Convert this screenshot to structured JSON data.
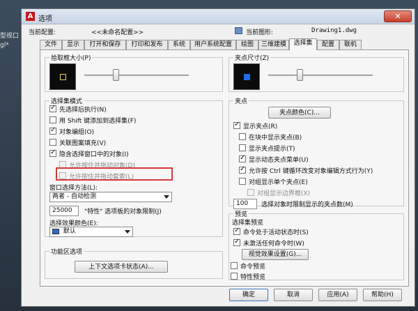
{
  "background": {
    "left_label_1": "型视口",
    "left_label_2": "gl*"
  },
  "window": {
    "title": "选项",
    "close_glyph": "✕"
  },
  "profile": {
    "current_label": "当前配置:",
    "current_value": "<<未命名配置>>",
    "drawing_label": "当前图形:",
    "drawing_value": "Drawing1.dwg"
  },
  "tabs": [
    "文件",
    "显示",
    "打开和保存",
    "打印和发布",
    "系统",
    "用户系统配置",
    "绘图",
    "三维建模",
    "选择集",
    "配置",
    "联机"
  ],
  "active_tab": "选择集",
  "pickbox": {
    "title": "拾取框大小(P)",
    "level": 0.3
  },
  "grip_size": {
    "title": "夹点尺寸(Z)",
    "level": 0.3
  },
  "selection_modes": {
    "title": "选择集模式",
    "items": [
      {
        "label": "先选择后执行(N)",
        "checked": true
      },
      {
        "label": "用 Shift 键添加到选择集(F)",
        "checked": false
      },
      {
        "label": "对象编组(O)",
        "checked": true
      },
      {
        "label": "关联图案填充(V)",
        "checked": false
      },
      {
        "label": "隐含选择窗口中的对象(I)",
        "checked": true
      },
      {
        "label": "允许按住并拖动对象(D)",
        "checked": false,
        "disabled": true
      },
      {
        "label": "允许按住并拖动套索(L)",
        "checked": false,
        "disabled": true
      }
    ],
    "window_method_label": "窗口选择方法(L):",
    "window_method_value": "两者 - 自动检测",
    "limit_value": "25000",
    "limit_label": "\"特性\" 选项板的对象限制(J)",
    "effect_color_label": "选择效果颜色(E):",
    "effect_color_value": "默认",
    "effect_color_swatch": "#2f6ad0"
  },
  "ribbon": {
    "title": "功能区选项",
    "button": "上下文选项卡状态(A)..."
  },
  "grips": {
    "title": "夹点",
    "color_button": "夹点颜色(C)...",
    "items": [
      {
        "label": "显示夹点(R)",
        "checked": true
      },
      {
        "label": "在块中显示夹点(B)",
        "checked": false
      },
      {
        "label": "显示夹点提示(T)",
        "checked": false
      },
      {
        "label": "显示动态夹点菜单(U)",
        "checked": true
      },
      {
        "label": "允许按 Ctrl 键循环改变对象编辑方式行为(Y)",
        "checked": true
      },
      {
        "label": "对组显示单个夹点(E)",
        "checked": false
      },
      {
        "label": "对组显示边界框(X)",
        "checked": false,
        "disabled": true
      }
    ],
    "limit_value": "100",
    "limit_label": "选择对象时限制显示的夹点数(M)"
  },
  "preview": {
    "title": "预览",
    "selection_title": "选择集预览",
    "items": [
      {
        "label": "命令处于活动状态时(S)",
        "checked": true
      },
      {
        "label": "未激活任何命令时(W)",
        "checked": true
      }
    ],
    "effects_button": "视觉效果设置(G)...",
    "command_preview": "命令预览",
    "property_preview": "特性预览"
  },
  "buttons": {
    "ok": "确定",
    "cancel": "取消",
    "apply": "应用(A)",
    "help": "帮助(H)"
  }
}
